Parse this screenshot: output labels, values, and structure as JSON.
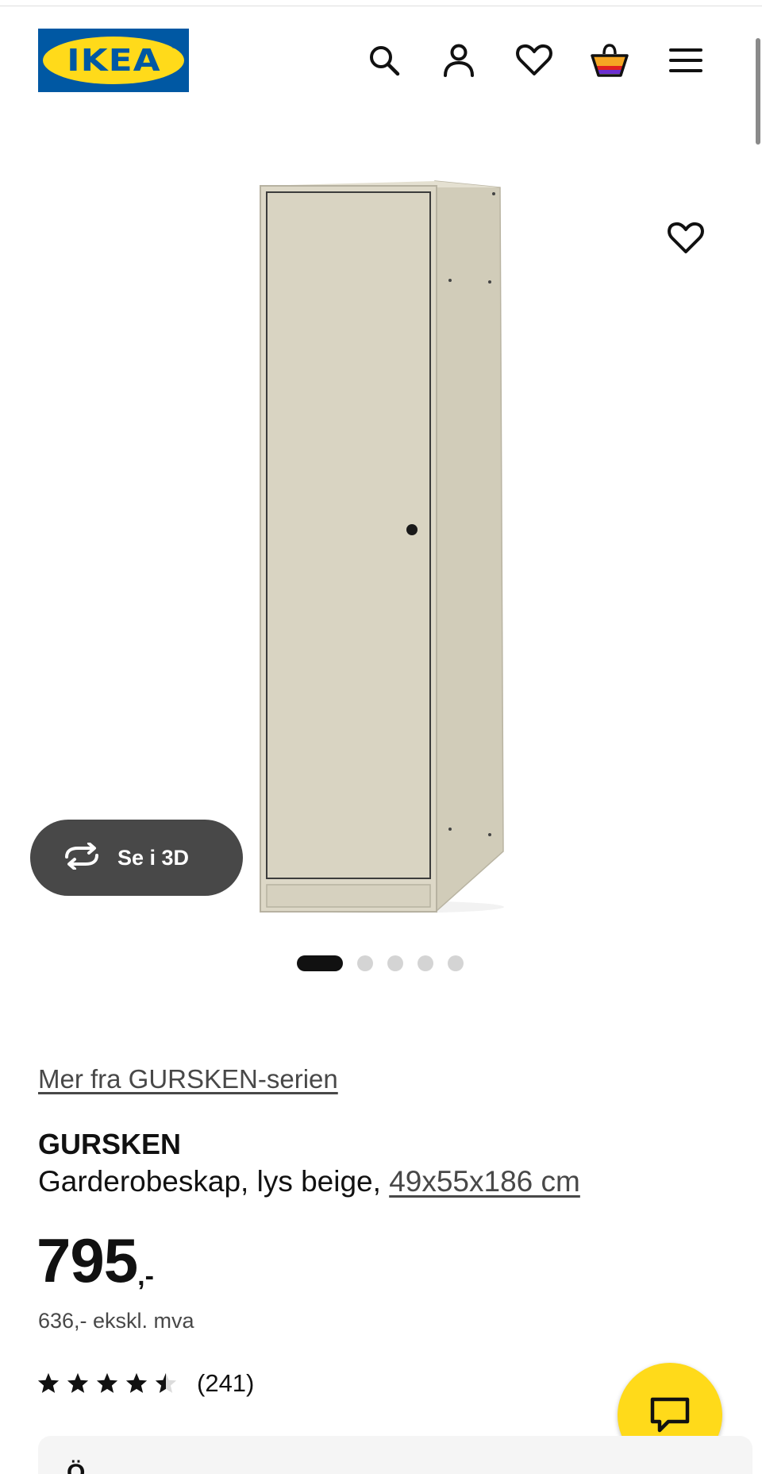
{
  "header": {
    "logo_text": "IKEA",
    "logo_mark": "®",
    "icons": [
      "search-icon",
      "user-icon",
      "heart-icon",
      "basket-icon",
      "menu-icon"
    ]
  },
  "gallery": {
    "view_3d_label": "Se i 3D",
    "image_count": 5,
    "active_index": 0
  },
  "product": {
    "series_link": "Mer fra GURSKEN-serien",
    "name": "GURSKEN",
    "description": "Garderobeskap, lys beige, ",
    "size": "49x55x186 cm",
    "price_integer": "795",
    "price_suffix": ",-",
    "price_ex_vat": "636,- ekskl. mva",
    "rating": 4.5,
    "rating_max": 5,
    "review_count": "(241)"
  },
  "bottom_card": {
    "text": "Ö"
  },
  "colors": {
    "ikea_blue": "#0058a3",
    "ikea_yellow": "#ffda1a",
    "text_dark": "#111111",
    "text_muted": "#484848",
    "cabinet_beige": "#d8d3c1"
  }
}
